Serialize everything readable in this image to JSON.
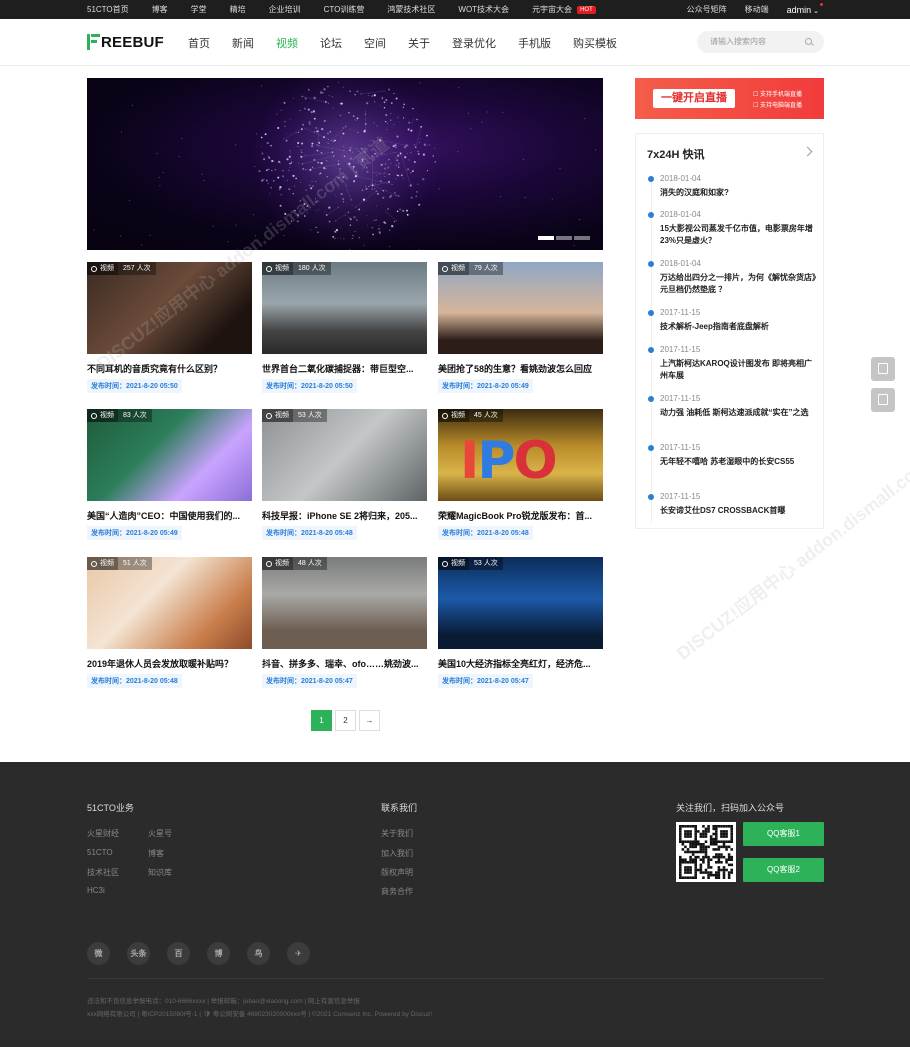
{
  "topbar": {
    "left": [
      "51CTO首页",
      "博客",
      "学堂",
      "精培",
      "企业培训",
      "CTO训练营",
      "鸿蒙技术社区",
      "WOT技术大会",
      "元宇宙大会"
    ],
    "hot": "HOT",
    "right": [
      "公众号矩阵",
      "移动端"
    ],
    "user": "admin"
  },
  "header": {
    "logo": "REEBUF",
    "nav": [
      "首页",
      "新闻",
      "视频",
      "论坛",
      "空间",
      "关于",
      "登录优化",
      "手机版",
      "购买模板"
    ],
    "active_index": 2,
    "search_placeholder": "请输入搜索内容"
  },
  "cards": [
    {
      "type": "视频",
      "views": "257 人次",
      "title": "不同耳机的音质究竟有什么区别？",
      "date": "发布时间：2021-8-20 05:50"
    },
    {
      "type": "视频",
      "views": "180 人次",
      "title": "世界首台二氧化碳捕捉器：带巨型空...",
      "date": "发布时间：2021-8-20 05:50"
    },
    {
      "type": "视频",
      "views": "79 人次",
      "title": "美团抢了58的生意？看姚劲波怎么回应",
      "date": "发布时间：2021-8-20 05:49"
    },
    {
      "type": "视频",
      "views": "83 人次",
      "title": "美国“人造肉”CEO：中国使用我们的...",
      "date": "发布时间：2021-8-20 05:49"
    },
    {
      "type": "视频",
      "views": "53 人次",
      "title": "科技早报：iPhone SE 2将归来，205...",
      "date": "发布时间：2021-8-20 05:48"
    },
    {
      "type": "视频",
      "views": "45 人次",
      "title": "荣耀MagicBook Pro锐龙版发布：首...",
      "date": "发布时间：2021-8-20 05:48"
    },
    {
      "type": "视频",
      "views": "51 人次",
      "title": "2019年退休人员会发放取暖补贴吗？",
      "date": "发布时间：2021-8-20 05:48"
    },
    {
      "type": "视频",
      "views": "48 人次",
      "title": "抖音、拼多多、瑞幸、ofo……姚劲波...",
      "date": "发布时间：2021-8-20 05:47"
    },
    {
      "type": "视频",
      "views": "53 人次",
      "title": "美国10大经济指标全亮红灯，经济危...",
      "date": "发布时间：2021-8-20 05:47"
    }
  ],
  "pager": {
    "pages": [
      "1",
      "2"
    ],
    "next": "→",
    "current": "1"
  },
  "ad": {
    "button": "一键开启直播",
    "line1": "☐ 支持手机端直播",
    "line2": "☐ 支持电脑端直播"
  },
  "news": {
    "title": "7x24H 快讯",
    "items": [
      {
        "date": "2018-01-04",
        "title": "消失的汉庭和如家?"
      },
      {
        "date": "2018-01-04",
        "title": "15大影视公司蒸发千亿市值，电影票房年增23%只是虚火？"
      },
      {
        "date": "2018-01-04",
        "title": "万达给出四分之一排片，为何《解忧杂货店》元旦档仍然垫底 ？"
      },
      {
        "date": "2017-11-15",
        "title": "技术解析-Jeep指南者底盘解析"
      },
      {
        "date": "2017-11-15",
        "title": "上汽斯柯达KAROQ设计图发布 即将亮相广州车展"
      },
      {
        "date": "2017-11-15",
        "title": "动力强 油耗低 斯柯达速派成就“实在”之选"
      },
      {
        "date": "2017-11-15",
        "title": "无年轻不嘻哈 苏老湿眼中的长安CS55"
      },
      {
        "date": "2017-11-15",
        "title": "长安谛艾仕DS7 CROSSBACK首曝"
      }
    ]
  },
  "footer": {
    "col1_title": "51CTO业务",
    "col1_links": [
      "火星财经",
      "火星号",
      "51CTO",
      "博客",
      "技术社区",
      "知识库",
      "HC3i"
    ],
    "col2_title": "联系我们",
    "col2_links": [
      "关于我们",
      "加入我们",
      "版权声明",
      "商务合作"
    ],
    "col3_title": "关注我们，扫码加入公众号",
    "qq1": "QQ客服1",
    "qq2": "QQ客服2",
    "social": [
      "微",
      "头条",
      "百",
      "博",
      "鸟",
      "✈"
    ],
    "copy1": "违法和不良信息举报电话：010-6666xxxx | 举报邮箱：jubao@xiaoong.com | 网上有害信息举报",
    "copy2": "xxx网络有限公司 | 粤ICP2015080l号-1 | 🛡 粤公网安备 469023020000xxx号 | ©2021 Comsenz Inc. Powered by Discuz!"
  },
  "watermark": "DISCUZ!应用中心 addon.dismall.com | 贰道"
}
